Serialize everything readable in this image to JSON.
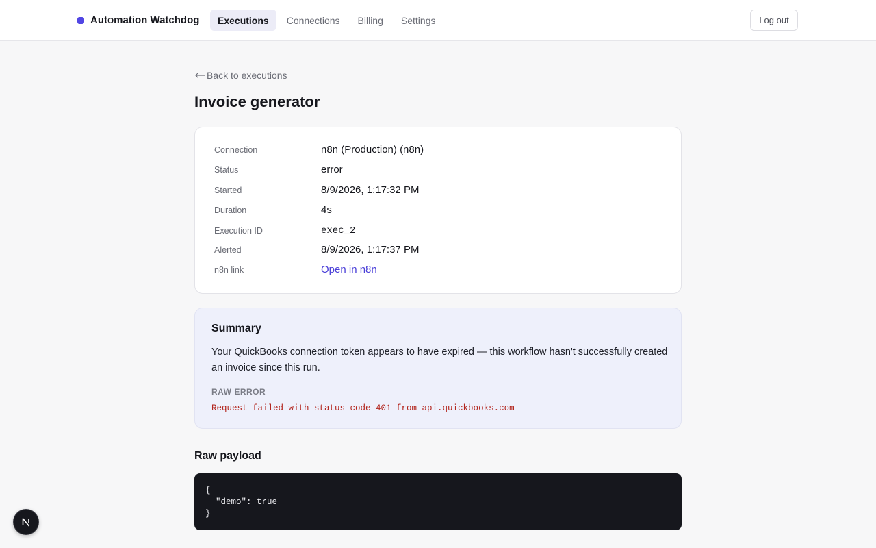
{
  "header": {
    "brand": "Automation Watchdog",
    "nav": [
      {
        "label": "Executions",
        "active": true
      },
      {
        "label": "Connections",
        "active": false
      },
      {
        "label": "Billing",
        "active": false
      },
      {
        "label": "Settings",
        "active": false
      }
    ],
    "logout_label": "Log out"
  },
  "page": {
    "back_label": "Back to executions",
    "title": "Invoice generator"
  },
  "details": {
    "rows": [
      {
        "label": "Connection",
        "value": "n8n (Production) (n8n)"
      },
      {
        "label": "Status",
        "value": "error"
      },
      {
        "label": "Started",
        "value": "8/9/2026, 1:17:32 PM"
      },
      {
        "label": "Duration",
        "value": "4s"
      },
      {
        "label": "Execution ID",
        "value": "exec_2"
      },
      {
        "label": "Alerted",
        "value": "8/9/2026, 1:17:37 PM"
      },
      {
        "label": "n8n link",
        "value": "Open in n8n"
      }
    ]
  },
  "summary": {
    "title": "Summary",
    "text": "Your QuickBooks connection token appears to have expired — this workflow hasn't successfully created an invoice since this run.",
    "raw_error_label": "RAW ERROR",
    "raw_error": "Request failed with status code 401 from api.quickbooks.com"
  },
  "payload": {
    "title": "Raw payload",
    "code": "{\n  \"demo\": true\n}"
  },
  "icons": {
    "back": "arrow-left-icon",
    "brand": "brand-dot-icon",
    "dev_badge": "next-logo-icon"
  },
  "colors": {
    "accent": "#5146e4",
    "link": "#4a3fd8",
    "error": "#b3261e",
    "code_bg": "#16171d",
    "summary_bg": "#eef0fb"
  }
}
